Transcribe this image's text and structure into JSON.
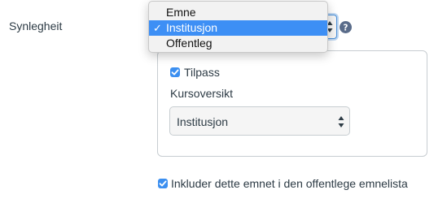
{
  "visibility": {
    "label": "Synlegheit",
    "options": [
      {
        "label": "Emne",
        "selected": false
      },
      {
        "label": "Institusjon",
        "selected": true
      },
      {
        "label": "Offentleg",
        "selected": false
      }
    ],
    "check_glyph": "✓",
    "help_icon": "question-circle-icon"
  },
  "customize": {
    "checkbox_label": "Tilpass",
    "checked": true,
    "course_overview_label": "Kursoversikt",
    "course_overview_value": "Institusjon"
  },
  "public_list": {
    "checkbox_label": "Inkluder dette emnet i den offentlege emnelista",
    "checked": true
  },
  "colors": {
    "accent": "#3d8ff5",
    "text": "#2d3b45",
    "help_icon": "#5a6c8a"
  }
}
